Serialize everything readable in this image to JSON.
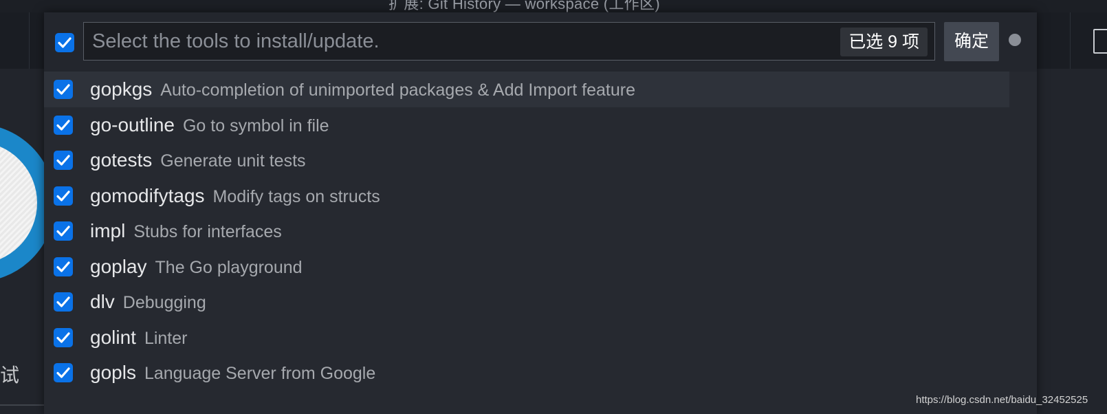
{
  "window": {
    "title_fragment": "扩展: Git History — workspace (工作区)"
  },
  "background": {
    "bottom_glyphs": "试 更"
  },
  "quick_pick": {
    "select_all_checked": true,
    "placeholder": "Select the tools to install/update.",
    "count_badge": "已选 9 项",
    "ok_button": "确定",
    "items": [
      {
        "name": "gopkgs",
        "description": "Auto-completion of unimported packages & Add Import feature",
        "checked": true,
        "active": true
      },
      {
        "name": "go-outline",
        "description": "Go to symbol in file",
        "checked": true,
        "active": false
      },
      {
        "name": "gotests",
        "description": "Generate unit tests",
        "checked": true,
        "active": false
      },
      {
        "name": "gomodifytags",
        "description": "Modify tags on structs",
        "checked": true,
        "active": false
      },
      {
        "name": "impl",
        "description": "Stubs for interfaces",
        "checked": true,
        "active": false
      },
      {
        "name": "goplay",
        "description": "The Go playground",
        "checked": true,
        "active": false
      },
      {
        "name": "dlv",
        "description": "Debugging",
        "checked": true,
        "active": false
      },
      {
        "name": "golint",
        "description": "Linter",
        "checked": true,
        "active": false
      },
      {
        "name": "gopls",
        "description": "Language Server from Google",
        "checked": true,
        "active": false
      }
    ]
  },
  "watermark": "https://blog.csdn.net/baidu_32452525",
  "colors": {
    "checkbox": "#0a72e8",
    "active_row": "#2e323a",
    "panel": "#262930",
    "logo_ring": "#1b87c9"
  }
}
